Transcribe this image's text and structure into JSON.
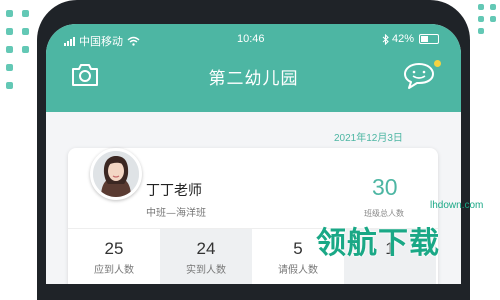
{
  "status_bar": {
    "carrier": "中国移动",
    "time": "10:46",
    "battery": "42%"
  },
  "header": {
    "title": "第二幼儿园",
    "left_icon": "camera-icon",
    "right_icon": "chat-icon",
    "colors": {
      "primary": "#4db6a3",
      "notification": "#f4d342"
    }
  },
  "date": "2021年12月3日",
  "teacher": {
    "name": "丁丁老师",
    "class": "中班—海洋班"
  },
  "summary": {
    "value": "30",
    "label": "班级总人数"
  },
  "stats": [
    {
      "value": "25",
      "label": "应到人数"
    },
    {
      "value": "24",
      "label": "实到人数"
    },
    {
      "value": "5",
      "label": "请假人数"
    },
    {
      "value": "1",
      "label": ""
    }
  ],
  "watermark": {
    "logo": "领航下载",
    "url": "lhdown.com"
  }
}
